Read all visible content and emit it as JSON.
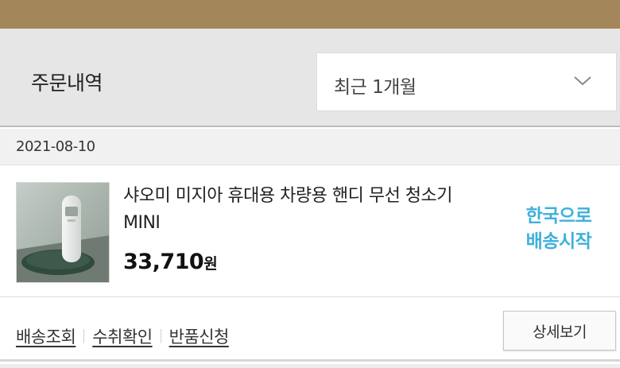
{
  "filter": {
    "title": "주문내역",
    "period_selected": "최근 1개월",
    "chevron_icon": "chevron-down-icon"
  },
  "order": {
    "date": "2021-08-10",
    "item": {
      "name": "샤오미 미지아 휴대용 차량용 핸디 무선 청소기 MINI",
      "price": "33,710",
      "currency": "원",
      "status_line1": "한국으로",
      "status_line2": "배송시작",
      "thumbnail_icon": "product-thumbnail"
    },
    "actions": {
      "track_label": "배송조회",
      "confirm_label": "수취확인",
      "return_label": "반품신청",
      "detail_label": "상세보기"
    }
  },
  "colors": {
    "header_bar": "#a3865a",
    "status_accent": "#3eb0dc"
  }
}
